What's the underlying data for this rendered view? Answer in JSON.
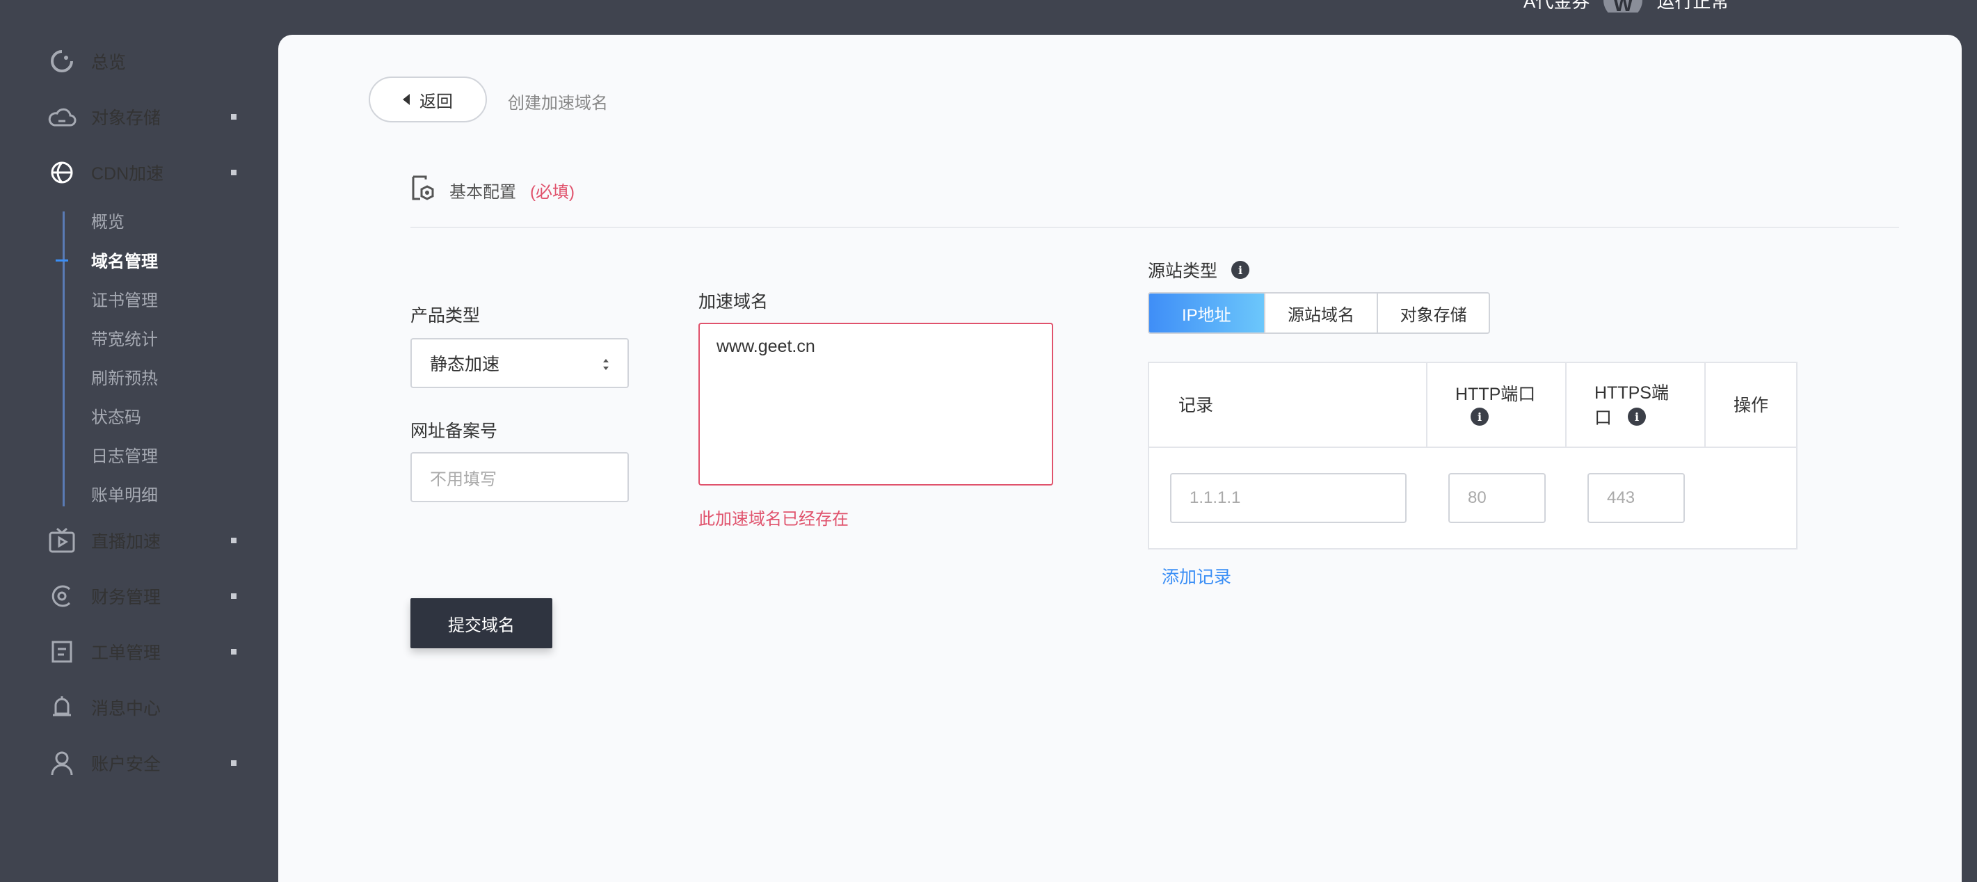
{
  "topbar": {
    "user_text": "A代金券",
    "avatar_initial": "W",
    "account_label": "运行正常"
  },
  "sidebar": {
    "items": [
      {
        "label": "总览",
        "icon": "loading-circle-icon"
      },
      {
        "label": "对象存储",
        "icon": "cloud-icon"
      },
      {
        "label": "CDN加速",
        "icon": "globe-icon"
      },
      {
        "label": "直播加速",
        "icon": "tv-icon"
      },
      {
        "label": "财务管理",
        "icon": "finance-icon"
      },
      {
        "label": "工单管理",
        "icon": "ticket-icon"
      },
      {
        "label": "消息中心",
        "icon": "bell-icon"
      },
      {
        "label": "账户安全",
        "icon": "user-icon"
      }
    ],
    "subitems": [
      "概览",
      "域名管理",
      "证书管理",
      "带宽统计",
      "刷新预热",
      "状态码",
      "日志管理",
      "账单明细"
    ]
  },
  "header": {
    "back_label": "返回",
    "crumb": "创建加速域名"
  },
  "section": {
    "title": "基本配置",
    "required": "(必填)"
  },
  "form": {
    "product_type_label": "产品类型",
    "product_type_value": "静态加速",
    "icp_label": "网址备案号",
    "icp_placeholder": "不用填写",
    "domain_label": "加速域名",
    "domain_value": "www.geet.cn",
    "domain_error": "此加速域名已经存在",
    "submit_label": "提交域名"
  },
  "origin": {
    "label": "源站类型",
    "tabs": [
      "IP地址",
      "源站域名",
      "对象存储"
    ],
    "table_headers": {
      "record": "记录",
      "http_line1": "HTTP端口",
      "https_line1": "HTTPS端",
      "https_line2": "口",
      "actions": "操作"
    },
    "row": {
      "ip_placeholder": "1.1.1.1",
      "http_placeholder": "80",
      "https_placeholder": "443"
    },
    "add_record": "添加记录"
  }
}
